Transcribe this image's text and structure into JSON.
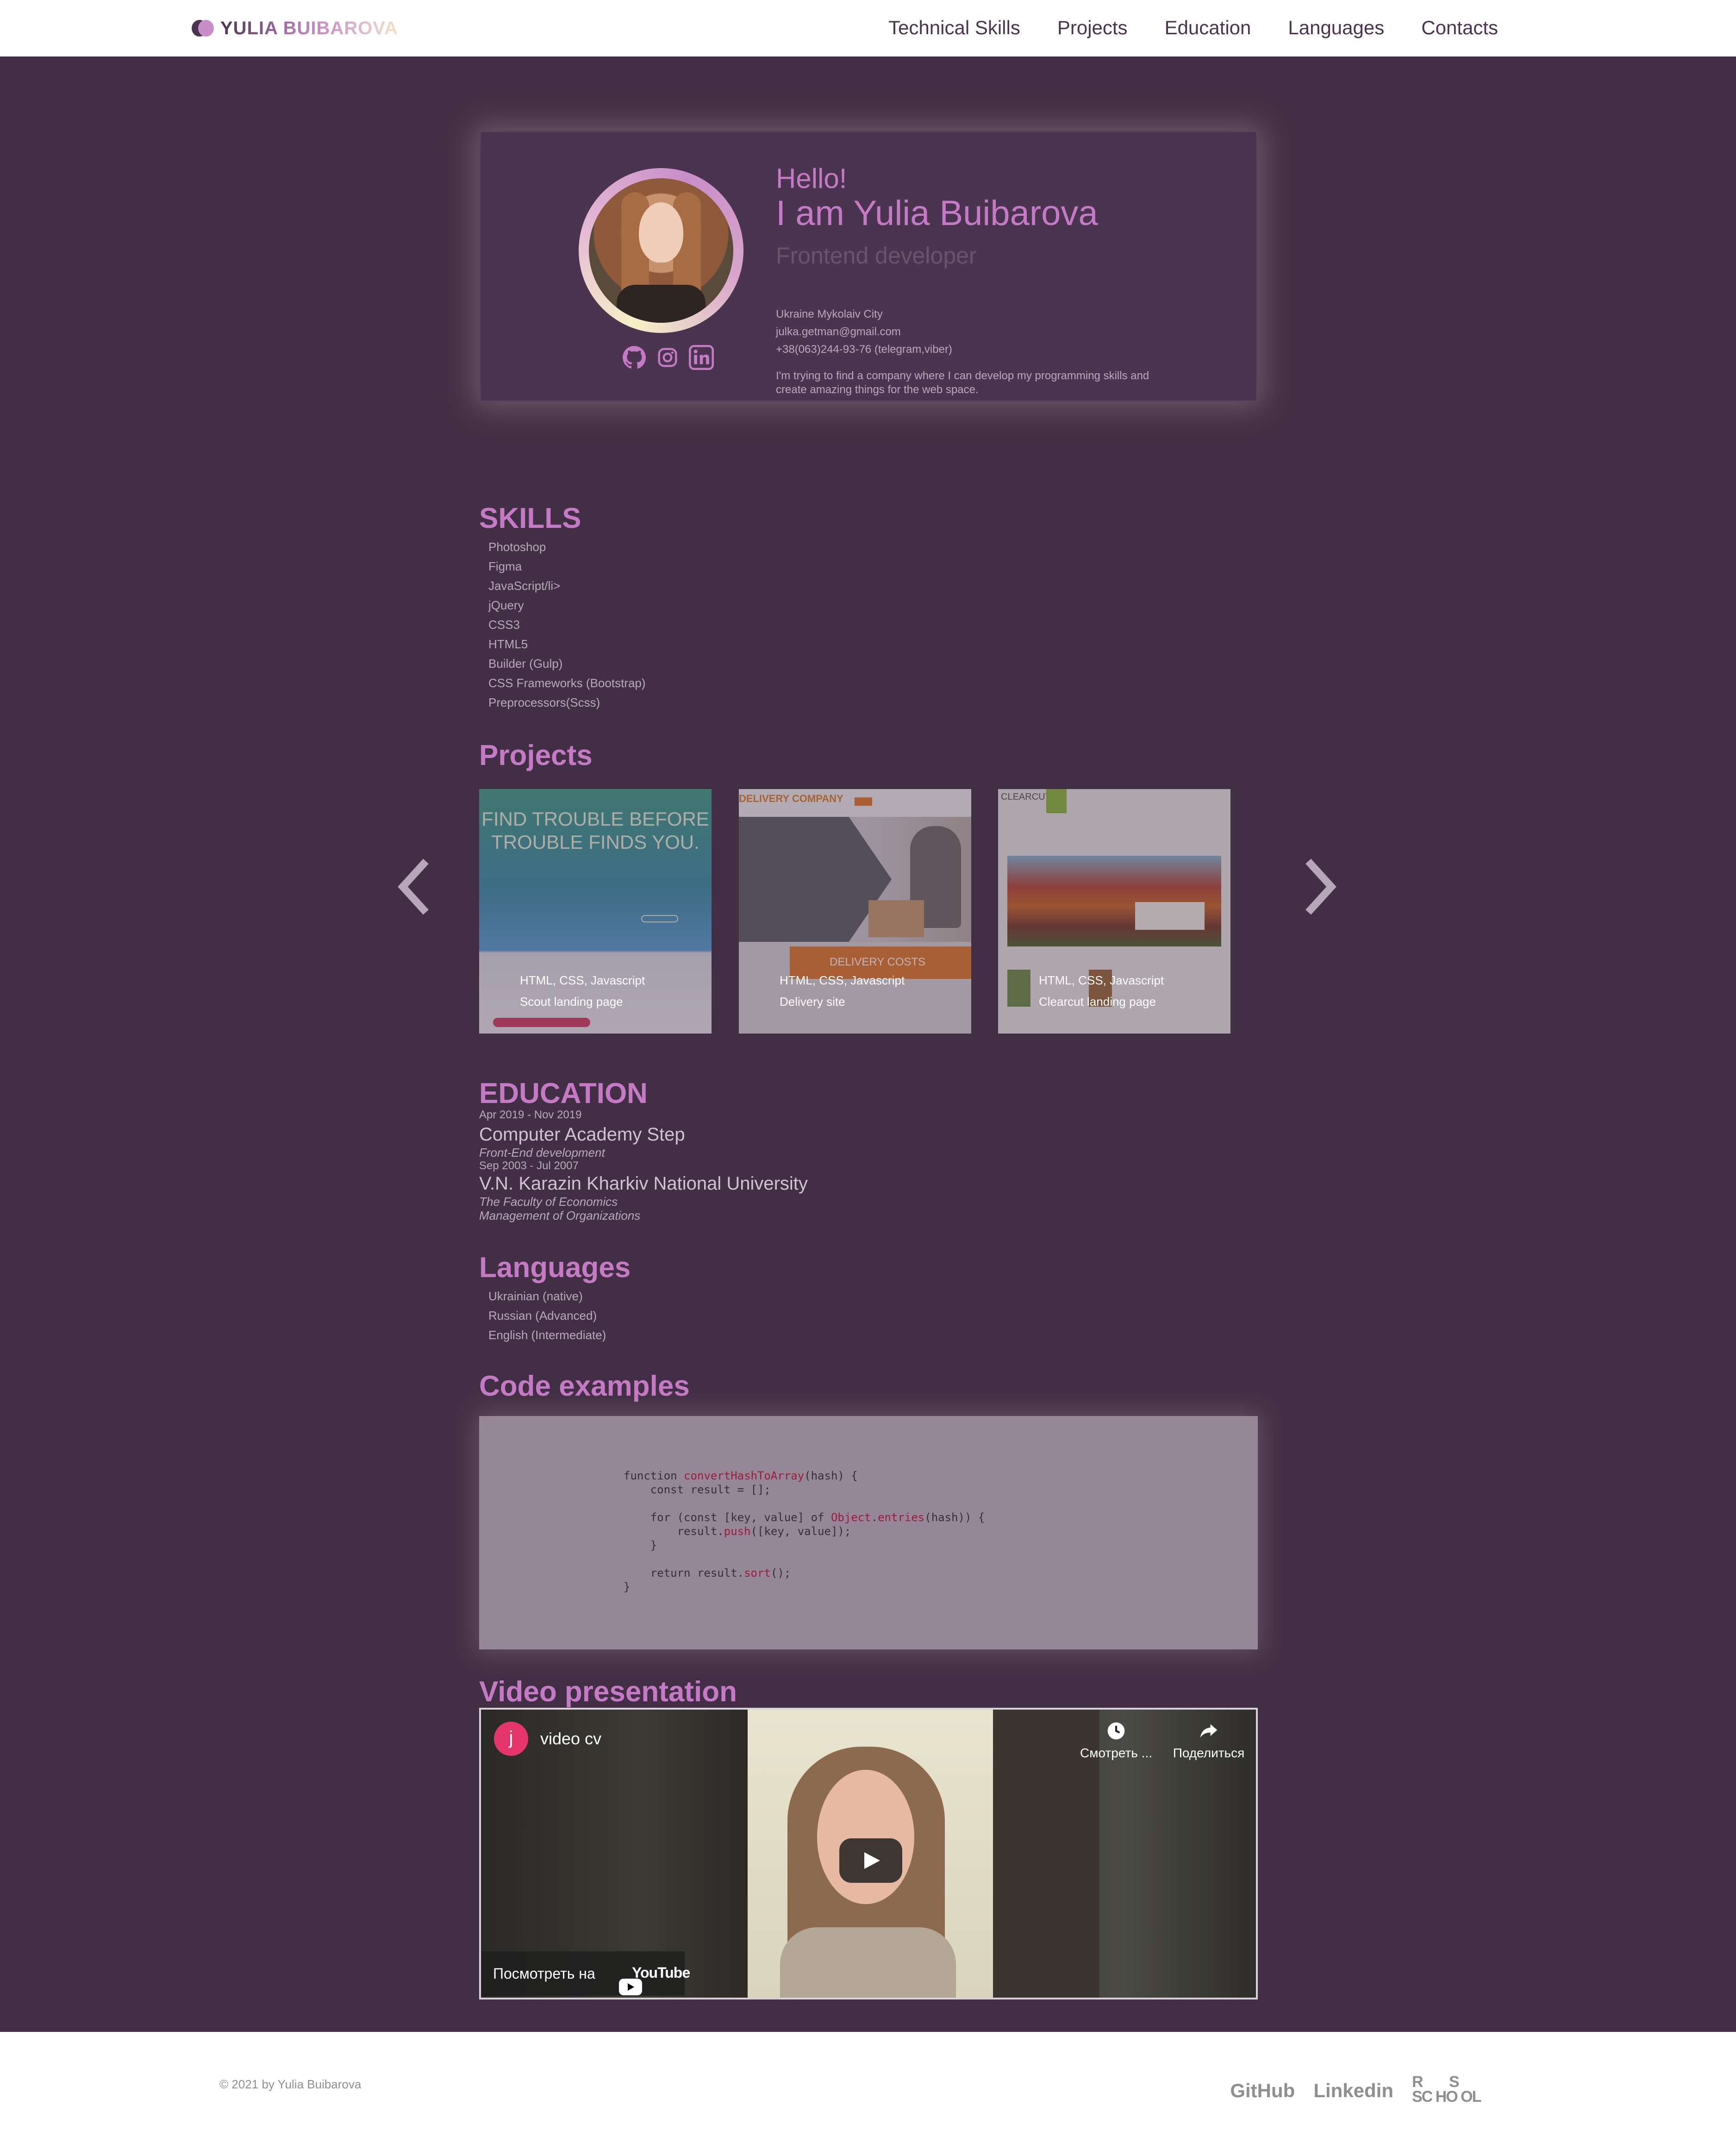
{
  "header": {
    "logo_text": "YULIA BUIBAROVA",
    "nav": [
      "Technical Skills",
      "Projects",
      "Education",
      "Languages",
      "Contacts"
    ]
  },
  "hero": {
    "greeting": "Hello!",
    "name": "I am Yulia Buibarova",
    "role": "Frontend developer",
    "location": "Ukraine Mykolaiv City",
    "email": "julka.getman@gmail.com",
    "phone": "+38(063)244-93-76 (telegram,viber)",
    "about": "I'm trying to find a company where I can develop my programming skills and create amazing things for the web space.",
    "socials": [
      "github-icon",
      "instagram-icon",
      "linkedin-icon"
    ]
  },
  "skills": {
    "title": "SKILLS",
    "items": [
      "Photoshop",
      "Figma",
      "JavaScript/li>",
      "jQuery",
      "CSS3",
      "HTML5",
      "Builder (Gulp)",
      "CSS Frameworks (Bootstrap)",
      "Preprocessors(Scss)"
    ]
  },
  "projects": {
    "title": "Projects",
    "items": [
      {
        "tech": "HTML, CSS, Javascript",
        "name": "Scout landing page",
        "headline": "FIND TROUBLE BEFORE TROUBLE FINDS YOU."
      },
      {
        "tech": "HTML, CSS, Javascript",
        "name": "Delivery site",
        "brand": "DELIVERY COMPANY",
        "banner": "DELIVERY COSTS"
      },
      {
        "tech": "HTML, CSS, Javascript",
        "name": "Clearcut landing page",
        "brand": "CLEARCUT"
      }
    ]
  },
  "education": {
    "title": "EDUCATION",
    "items": [
      {
        "dates": "Apr 2019 - Nov 2019",
        "school": "Computer Academy Step",
        "details": [
          "Front-End development"
        ]
      },
      {
        "dates": "Sep 2003 - Jul 2007",
        "school": "V.N. Karazin Kharkiv National University",
        "details": [
          "The Faculty of Economics",
          "Management of Organizations"
        ]
      }
    ]
  },
  "languages": {
    "title": "Languages",
    "items": [
      "Ukrainian (native)",
      "Russian (Advanced)",
      "English (Intermediate)"
    ]
  },
  "code": {
    "title": "Code examples",
    "lines": [
      "function convertHashToArray(hash) {",
      "    const result = [];",
      "",
      "    for (const [key, value] of Object.entries(hash)) {",
      "        result.push([key, value]);",
      "    }",
      "",
      "    return result.sort();",
      "}"
    ]
  },
  "video": {
    "title": "Video presentation",
    "channel_initial": "j",
    "video_title": "video cv",
    "watch_later": "Смотреть ...",
    "share": "Поделиться",
    "watch_on": "Посмотреть на",
    "youtube": "YouTube"
  },
  "footer": {
    "copyright": "© 2021 by Yulia Buibarova",
    "links": [
      "GitHub",
      "Linkedin"
    ],
    "school_logo": "RS SCHOOL"
  },
  "colors": {
    "background": "#432f45",
    "card": "#4a3450",
    "accent": "#c57ac6",
    "text_muted": "#b9a9bd"
  }
}
